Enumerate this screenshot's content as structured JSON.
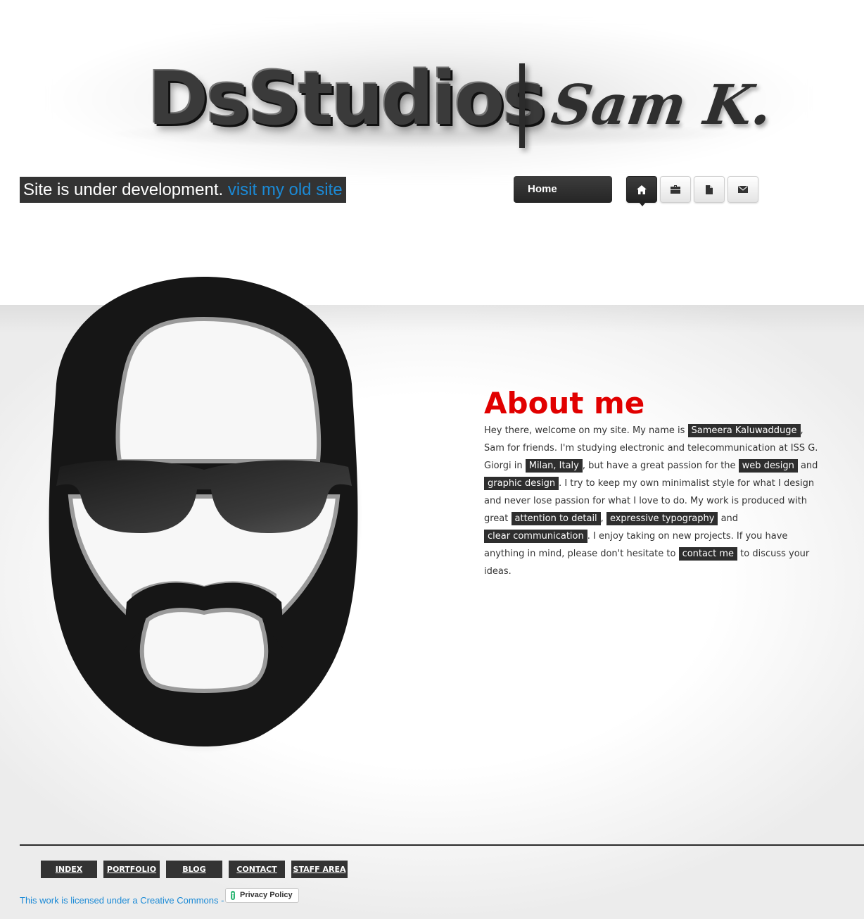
{
  "header": {
    "logo_main": "DsStudios",
    "logo_signature": "Sam K."
  },
  "notice": {
    "text": "Site is under development. ",
    "link": "visit my old site"
  },
  "nav": {
    "current_label": "Home",
    "buttons": [
      {
        "icon": "home-icon",
        "active": true
      },
      {
        "icon": "briefcase-icon",
        "active": false
      },
      {
        "icon": "document-icon",
        "active": false
      },
      {
        "icon": "mail-icon",
        "active": false
      }
    ]
  },
  "about": {
    "title": "About me",
    "p1": "Hey there, welcome on my site. My name is ",
    "name": "Sameera Kaluwadduge",
    "p2": ", Sam for friends. I'm studying electronic and telecommunication at ISS G. Giorgi in ",
    "place": "Milan, Italy",
    "p3": ", but have a great passion for the ",
    "web_design": "web design",
    "and1": " and ",
    "graphic_design": "graphic design",
    "p4": ". I try to keep my own minimalist style for what I design and never lose passion for what I love to do. My work is produced with great ",
    "attention": "attention to detail",
    "comma": ", ",
    "typography": "expressive typography",
    "and2": " and ",
    "communication": "clear communication",
    "p5": ". I enjoy taking on new projects. If you have anything in mind, please don't hesitate to ",
    "contact": "contact me",
    "p6": " to discuss your ideas."
  },
  "footer": {
    "links": [
      "INDEX",
      "PORTFOLIO",
      "BLOG",
      "CONTACT",
      "STAFF AREA"
    ],
    "license": "This work is licensed under a Creative Commons -",
    "privacy": "Privacy Policy"
  },
  "colors": {
    "accent_red": "#e10000",
    "link_blue": "#1b8ad6",
    "dark": "#333333"
  }
}
